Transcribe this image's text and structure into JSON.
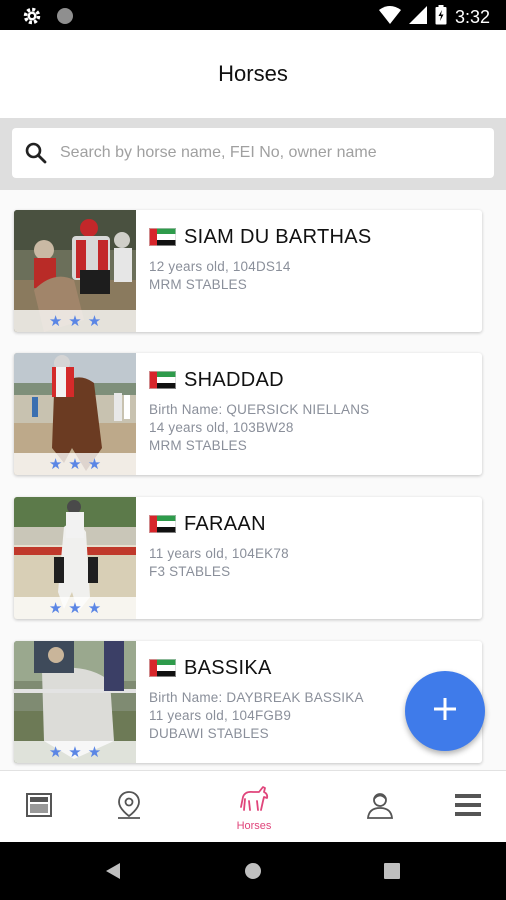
{
  "status_bar": {
    "time": "3:32",
    "icons": [
      "settings-icon",
      "circle-icon",
      "wifi-icon",
      "signal-icon",
      "battery-icon"
    ]
  },
  "header": {
    "title": "Horses"
  },
  "search": {
    "placeholder": "Search by horse name, FEI No, owner name",
    "value": ""
  },
  "colors": {
    "accent": "#3f7bea",
    "nav_active": "#e0457b",
    "star": "#5b86e5",
    "meta_text": "#8a8f9a"
  },
  "horses": [
    {
      "name": "SIAM DU BARTHAS",
      "lines": [
        "12 years old, 104DS14",
        "MRM STABLES"
      ],
      "stars": 3,
      "flag": "UAE"
    },
    {
      "name": "SHADDAD",
      "lines": [
        "Birth Name: QUERSICK NIELLANS",
        "14 years old, 103BW28",
        "MRM STABLES"
      ],
      "stars": 3,
      "flag": "UAE"
    },
    {
      "name": "FARAAN",
      "lines": [
        "11 years old, 104EK78",
        "F3 STABLES"
      ],
      "stars": 3,
      "flag": "UAE"
    },
    {
      "name": "BASSIKA",
      "lines": [
        "Birth Name: DAYBREAK BASSIKA",
        "11 years old, 104FGB9",
        "DUBAWI STABLES"
      ],
      "stars": 3,
      "flag": "UAE"
    }
  ],
  "fab": {
    "icon": "plus-icon"
  },
  "bottom_nav": {
    "items": [
      {
        "icon": "news-icon",
        "label": ""
      },
      {
        "icon": "location-pin-icon",
        "label": ""
      },
      {
        "icon": "horse-icon",
        "label": "Horses",
        "active": true
      },
      {
        "icon": "rider-icon",
        "label": ""
      },
      {
        "icon": "menu-icon",
        "label": ""
      }
    ]
  }
}
